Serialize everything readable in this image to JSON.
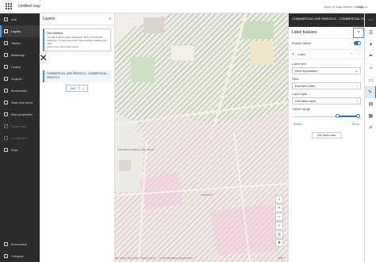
{
  "topbar": {
    "title": "Untitled map",
    "open_link": "Open in Map Viewer Classic",
    "signin": "Sign In"
  },
  "nav": {
    "items": [
      {
        "label": "Add",
        "state": "normal"
      },
      {
        "label": "Layers",
        "state": "active"
      },
      {
        "label": "Tables",
        "state": "normal"
      },
      {
        "label": "Basemap",
        "state": "normal"
      },
      {
        "label": "Charts",
        "state": "normal"
      },
      {
        "label": "Legend",
        "state": "normal"
      },
      {
        "label": "Bookmarks",
        "state": "normal"
      },
      {
        "label": "Save and open",
        "state": "normal"
      },
      {
        "label": "Map properties",
        "state": "normal"
      },
      {
        "label": "Share map",
        "state": "dim"
      },
      {
        "label": "Create app",
        "state": "dim"
      },
      {
        "label": "Print",
        "state": "normal"
      }
    ],
    "bottom": [
      {
        "label": "Information"
      },
      {
        "label": "Collapse"
      }
    ]
  },
  "layers": {
    "title": "Layers",
    "close": "«",
    "get_started": {
      "title": "Get started",
      "body": "You can explore maps, add layers, and more without signing in. To save your work, sign in before creating your map.",
      "link": "Learn more about Map Viewer",
      "close": "×"
    },
    "layer_name": "COMMERCIAL USE PARCELS - COMMERCIAL PARCELS",
    "layer_menu": "···",
    "add_label": "Add",
    "add_menu": "⌄"
  },
  "panel": {
    "header": "COMMERCIAL USE PARCELS - COMMERCIAL PARCELS",
    "subtitle": "Label features",
    "close": "×",
    "enable_labels": "Enable labels",
    "enable_labels_on": true,
    "label_class": "Label",
    "label_field_title": "Label field",
    "label_field_value": "New expression",
    "filter_title": "Filter",
    "filter_value": "Edit label filter",
    "label_style_title": "Label style",
    "label_style_value": "Edit label style",
    "visible_range_title": "Visible range",
    "range_min_label": "Streets",
    "range_max_label": "Room",
    "add_label_class": "Add label class"
  },
  "map": {
    "attribution": "Esri, NASA, NGA, USGS, FEMA | City of ... , © OpenStreetMap, Microsoft, Esri ...",
    "logo": "esri",
    "labels": [
      "Cathedral & Academy High School",
      "Lakewood"
    ]
  },
  "colors": {
    "nav_bg": "#2b2b2b",
    "accent": "#2b6fb6",
    "green_parcel": "#5a8a4a",
    "pink_parcel": "#e07aa8"
  }
}
